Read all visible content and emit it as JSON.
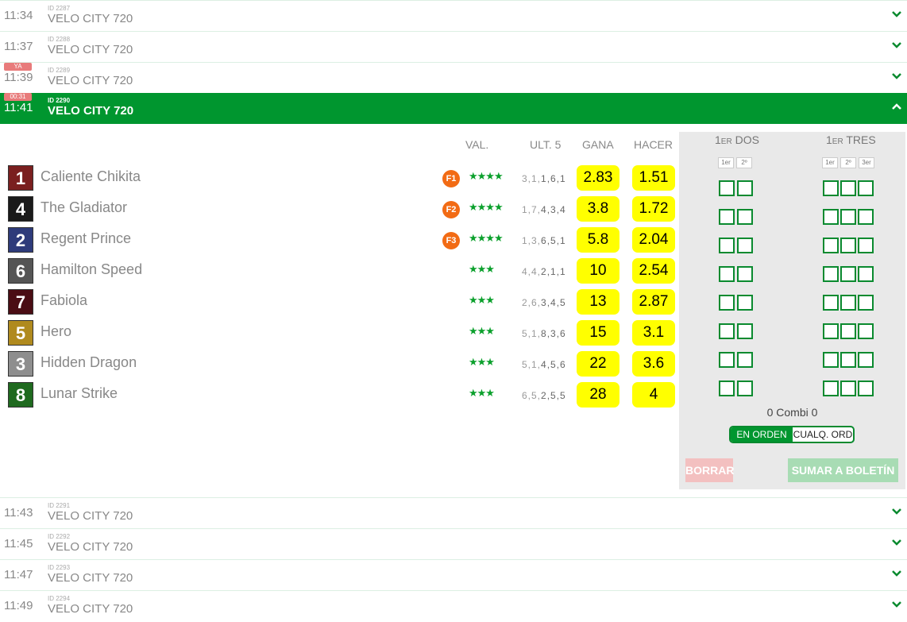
{
  "races_before": [
    {
      "time": "11:34",
      "id": "ID 2287",
      "name": "VELO CITY 720"
    },
    {
      "time": "11:37",
      "id": "ID 2288",
      "name": "VELO CITY 720"
    },
    {
      "time": "11:39",
      "id": "ID 2289",
      "name": "VELO CITY 720",
      "badge": "YA"
    }
  ],
  "active_race": {
    "time": "11:41",
    "id": "ID 2290",
    "name": "VELO CITY 720",
    "badge": "00:31"
  },
  "races_after": [
    {
      "time": "11:43",
      "id": "ID 2291",
      "name": "VELO CITY 720"
    },
    {
      "time": "11:45",
      "id": "ID 2292",
      "name": "VELO CITY 720"
    },
    {
      "time": "11:47",
      "id": "ID 2293",
      "name": "VELO CITY 720"
    },
    {
      "time": "11:49",
      "id": "ID 2294",
      "name": "VELO CITY 720"
    }
  ],
  "headers": {
    "val": "VAL.",
    "ult5": "ULT. 5",
    "gana": "GANA",
    "hacer": "HACER"
  },
  "runners": [
    {
      "num": "1",
      "name": "Caliente Chikita",
      "fav": "F1",
      "stars": "★★★★",
      "last5": "3,1,1,6,1",
      "win": "2.83",
      "place": "1.51",
      "color": "#7a1f1f"
    },
    {
      "num": "4",
      "name": "The Gladiator",
      "fav": "F2",
      "stars": "★★★★",
      "last5": "1,7,4,3,4",
      "win": "3.8",
      "place": "1.72",
      "color": "#1a1a1a"
    },
    {
      "num": "2",
      "name": "Regent Prince",
      "fav": "F3",
      "stars": "★★★★",
      "last5": "1,3,6,5,1",
      "win": "5.8",
      "place": "2.04",
      "color": "#2e3b7a"
    },
    {
      "num": "6",
      "name": "Hamilton Speed",
      "fav": "",
      "stars": "★★★",
      "last5": "4,4,2,1,1",
      "win": "10",
      "place": "2.54",
      "color": "#555555"
    },
    {
      "num": "7",
      "name": "Fabiola",
      "fav": "",
      "stars": "★★★",
      "last5": "2,6,3,4,5",
      "win": "13",
      "place": "2.87",
      "color": "#4a0d14"
    },
    {
      "num": "5",
      "name": "Hero",
      "fav": "",
      "stars": "★★★",
      "last5": "5,1,8,3,6",
      "win": "15",
      "place": "3.1",
      "color": "#b08a1e"
    },
    {
      "num": "3",
      "name": "Hidden Dragon",
      "fav": "",
      "stars": "★★★",
      "last5": "5,1,4,5,6",
      "win": "22",
      "place": "3.6",
      "color": "#8e8e8e"
    },
    {
      "num": "8",
      "name": "Lunar Strike",
      "fav": "",
      "stars": "★★★",
      "last5": "6,5,2,5,5",
      "win": "28",
      "place": "4",
      "color": "#1f6a1f"
    }
  ],
  "betbox": {
    "dos_title_a": "1",
    "dos_title_b": "ER",
    "dos_title_c": " DOS",
    "tres_title_a": "1",
    "tres_title_b": "ER",
    "tres_title_c": " TRES",
    "dos_ticks": [
      "1er",
      "2º"
    ],
    "tres_ticks": [
      "1er",
      "2º",
      "3er"
    ],
    "combi": "0 Combi 0",
    "toggle_a": "EN ORDEN",
    "toggle_b": "CUALQ. ORD",
    "borrar": "BORRAR",
    "sumar": "SUMAR A BOLETÍN"
  },
  "colors": {
    "brand_green": "#00962f",
    "odds_yellow": "#ffff00",
    "fav_orange": "#f26b14"
  }
}
